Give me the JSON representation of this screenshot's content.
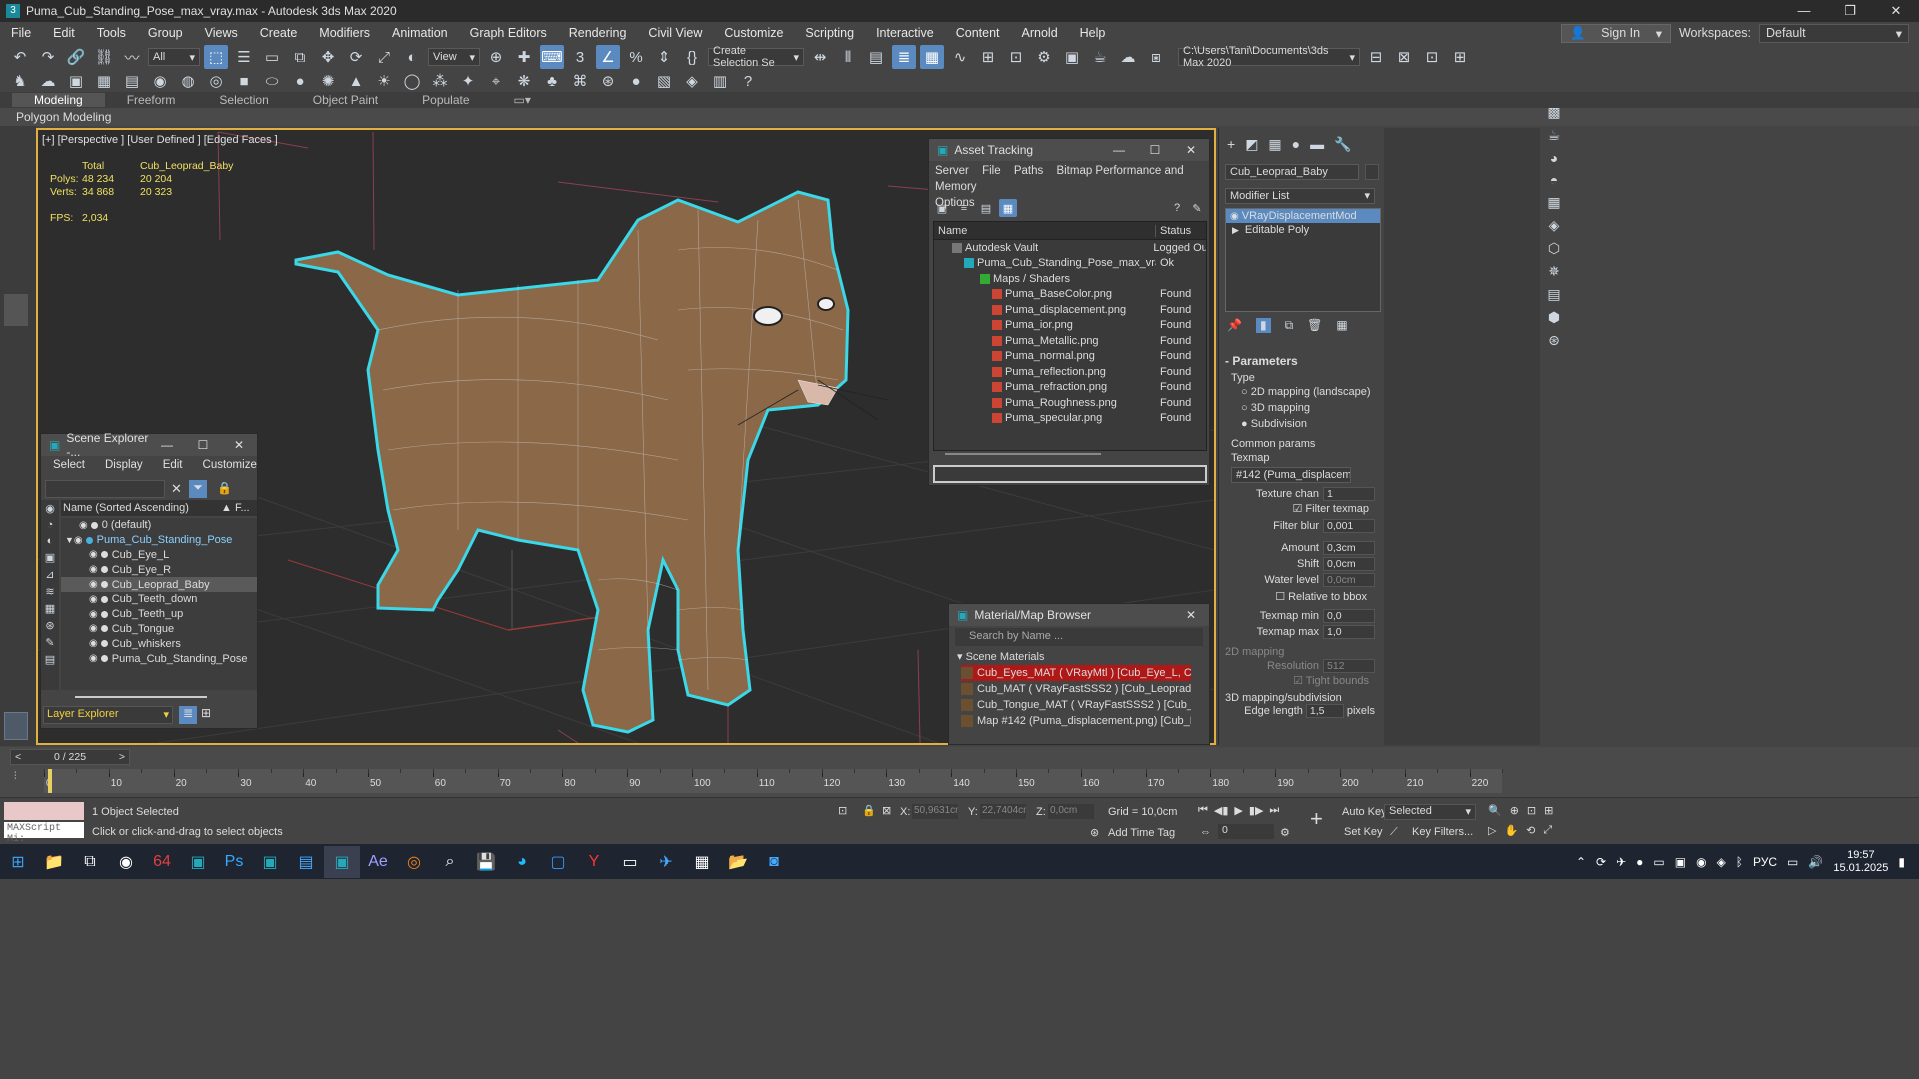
{
  "window": {
    "title": "Puma_Cub_Standing_Pose_max_vray.max - Autodesk 3ds Max 2020",
    "app_icon": "3"
  },
  "menubar": {
    "items": [
      "File",
      "Edit",
      "Tools",
      "Group",
      "Views",
      "Create",
      "Modifiers",
      "Animation",
      "Graph Editors",
      "Rendering",
      "Civil View",
      "Customize",
      "Scripting",
      "Interactive",
      "Content",
      "Arnold",
      "Help"
    ],
    "sign_in": "Sign In",
    "workspaces_label": "Workspaces:",
    "workspace": "Default"
  },
  "toolbar": {
    "filter_select": "All",
    "view_select": "View",
    "create_selection_set": "Create Selection Se",
    "project_path": "C:\\Users\\Tani\\Documents\\3ds Max 2020"
  },
  "ribbon": {
    "tabs": [
      "Modeling",
      "Freeform",
      "Selection",
      "Object Paint",
      "Populate"
    ],
    "sub_label": "Polygon Modeling"
  },
  "viewport": {
    "label": "[+] [Perspective ] [User Defined ] [Edged Faces ]",
    "stats": {
      "col_total": "Total",
      "col_object": "Cub_Leoprad_Baby",
      "polys_label": "Polys:",
      "polys_total": "48 234",
      "polys_obj": "20 204",
      "verts_label": "Verts:",
      "verts_total": "34 868",
      "verts_obj": "20 323",
      "fps_label": "FPS:",
      "fps_value": "2,034"
    }
  },
  "asset_tracking": {
    "title": "Asset Tracking",
    "menu": [
      "Server",
      "File",
      "Paths",
      "Bitmap Performance and Memory"
    ],
    "menu2": "Options",
    "col_name": "Name",
    "col_status": "Status",
    "rows": [
      {
        "name": "Autodesk Vault",
        "status": "Logged Ou",
        "indent": 18,
        "icon": "vault"
      },
      {
        "name": "Puma_Cub_Standing_Pose_max_vray....",
        "status": "Ok",
        "indent": 30,
        "icon": "max"
      },
      {
        "name": "Maps / Shaders",
        "status": "",
        "indent": 46,
        "icon": "maps"
      },
      {
        "name": "Puma_BaseColor.png",
        "status": "Found",
        "indent": 58,
        "icon": "png"
      },
      {
        "name": "Puma_displacement.png",
        "status": "Found",
        "indent": 58,
        "icon": "png"
      },
      {
        "name": "Puma_ior.png",
        "status": "Found",
        "indent": 58,
        "icon": "png"
      },
      {
        "name": "Puma_Metallic.png",
        "status": "Found",
        "indent": 58,
        "icon": "png"
      },
      {
        "name": "Puma_normal.png",
        "status": "Found",
        "indent": 58,
        "icon": "png"
      },
      {
        "name": "Puma_reflection.png",
        "status": "Found",
        "indent": 58,
        "icon": "png"
      },
      {
        "name": "Puma_refraction.png",
        "status": "Found",
        "indent": 58,
        "icon": "png"
      },
      {
        "name": "Puma_Roughness.png",
        "status": "Found",
        "indent": 58,
        "icon": "png"
      },
      {
        "name": "Puma_specular.png",
        "status": "Found",
        "indent": 58,
        "icon": "png"
      }
    ]
  },
  "scene_explorer": {
    "title": "Scene Explorer -...",
    "menu": [
      "Select",
      "Display",
      "Edit",
      "Customize"
    ],
    "column_header": "Name (Sorted Ascending)",
    "column_f": "▲ F...",
    "rows": [
      {
        "name": "0 (default)",
        "level": 0,
        "selected": false
      },
      {
        "name": "Puma_Cub_Standing_Pose",
        "level": 0,
        "selected": false,
        "group": true
      },
      {
        "name": "Cub_Eye_L",
        "level": 1,
        "selected": false
      },
      {
        "name": "Cub_Eye_R",
        "level": 1,
        "selected": false
      },
      {
        "name": "Cub_Leoprad_Baby",
        "level": 1,
        "selected": true
      },
      {
        "name": "Cub_Teeth_down",
        "level": 1,
        "selected": false
      },
      {
        "name": "Cub_Teeth_up",
        "level": 1,
        "selected": false
      },
      {
        "name": "Cub_Tongue",
        "level": 1,
        "selected": false
      },
      {
        "name": "Cub_whiskers",
        "level": 1,
        "selected": false
      },
      {
        "name": "Puma_Cub_Standing_Pose",
        "level": 1,
        "selected": false
      }
    ],
    "layer_explorer": "Layer Explorer"
  },
  "material_browser": {
    "title": "Material/Map Browser",
    "search_placeholder": "Search by Name ...",
    "section": "Scene Materials",
    "rows": [
      {
        "text": "Cub_Eyes_MAT ( VRayMtl ) [Cub_Eye_L, Cub_Ey...",
        "highlight": true
      },
      {
        "text": "Cub_MAT ( VRayFastSSS2 ) [Cub_Leoprad_Baby...",
        "highlight": false
      },
      {
        "text": "Cub_Tongue_MAT ( VRayFastSSS2 ) [Cub_Tong...",
        "highlight": false
      },
      {
        "text": "Map #142 (Puma_displacement.png) [Cub_Leopr...",
        "highlight": false
      }
    ]
  },
  "command_panel": {
    "object_name": "Cub_Leoprad_Baby",
    "modifier_list": "Modifier List",
    "stack": [
      "VRayDisplacementMod",
      "Editable Poly"
    ],
    "rollout_title": "Parameters",
    "type_label": "Type",
    "type_options": [
      "2D mapping (landscape)",
      "3D mapping",
      "Subdivision"
    ],
    "type_selected": "Subdivision",
    "common_params": "Common params",
    "texmap_label": "Texmap",
    "texmap_value": "#142 (Puma_displacement.p",
    "texture_chan_label": "Texture chan",
    "texture_chan_value": "1",
    "filter_texmap": "Filter texmap",
    "filter_blur_label": "Filter blur",
    "filter_blur_value": "0,001",
    "amount_label": "Amount",
    "amount_value": "0,3cm",
    "shift_label": "Shift",
    "shift_value": "0,0cm",
    "water_level_label": "Water level",
    "water_level_value": "0,0cm",
    "relative_to_bbox": "Relative to bbox",
    "texmap_min_label": "Texmap min",
    "texmap_min_value": "0,0",
    "texmap_max_label": "Texmap max",
    "texmap_max_value": "1,0",
    "mapping_2d": "2D mapping",
    "resolution_label": "Resolution",
    "resolution_value": "512",
    "tight_bounds": "Tight bounds",
    "mapping_3d": "3D mapping/subdivision",
    "edge_length_label": "Edge length",
    "edge_length_value": "1,5",
    "edge_length_unit": "pixels"
  },
  "timeline": {
    "frame_counter": "0 / 225",
    "ticks": [
      "0",
      "10",
      "20",
      "30",
      "40",
      "50",
      "60",
      "70",
      "80",
      "90",
      "100",
      "110",
      "120",
      "130",
      "140",
      "150",
      "160",
      "170",
      "180",
      "190",
      "200",
      "210",
      "220"
    ]
  },
  "status": {
    "maxscript": "MAXScript Mi:",
    "objects_selected": "1 Object Selected",
    "prompt": "Click or click-and-drag to select objects",
    "x_label": "X:",
    "x_value": "50,9631cm",
    "y_label": "Y:",
    "y_value": "22,7404cm",
    "z_label": "Z:",
    "z_value": "0,0cm",
    "grid": "Grid = 10,0cm",
    "add_time_tag": "Add Time Tag",
    "auto_key": "Auto Key",
    "set_key": "Set Key",
    "selected_dropdown": "Selected",
    "key_filters": "Key Filters...",
    "frame_value": "0"
  },
  "taskbar": {
    "lang": "РУС",
    "time": "19:57",
    "date": "15.01.2025"
  }
}
